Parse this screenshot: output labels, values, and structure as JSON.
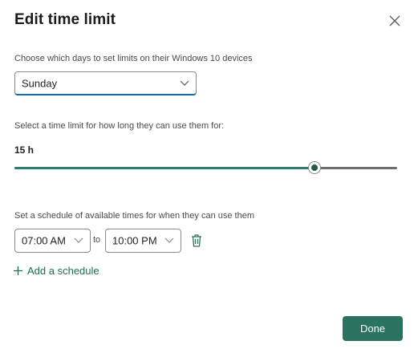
{
  "dialog": {
    "title": "Edit time limit",
    "close_icon": "close-icon"
  },
  "days": {
    "label": "Choose which days to set limits on their Windows 10 devices",
    "selected": "Sunday"
  },
  "limit": {
    "label": "Select a time limit for how long they can use them for:",
    "value_text": "15 h",
    "slider_fraction": 0.785
  },
  "schedule": {
    "label": "Set a schedule of available times for when they can use them",
    "start": "07:00 AM",
    "to_text": "to",
    "end": "10:00 PM",
    "delete_icon": "trash-icon",
    "add_label": "Add a schedule"
  },
  "footer": {
    "done_label": "Done"
  },
  "colors": {
    "accent": "#2b7361",
    "focus": "#0f6cbd"
  }
}
